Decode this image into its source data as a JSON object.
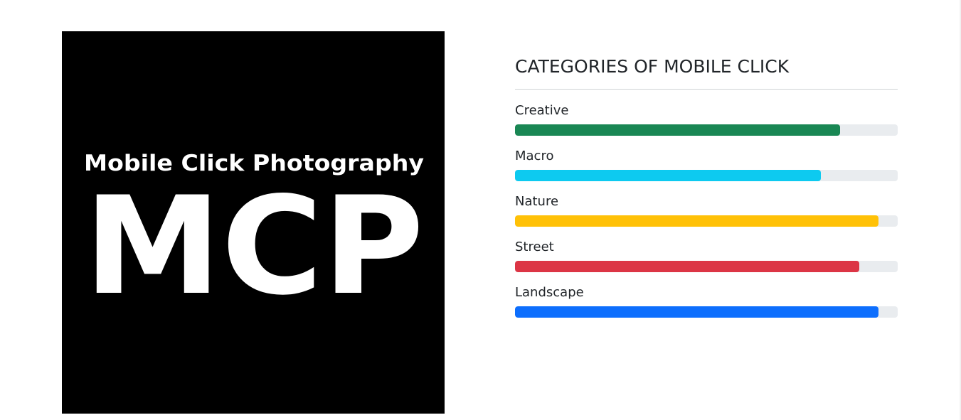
{
  "logo": {
    "line1": "Mobile Click Photography",
    "line2": "MCP",
    "background": "#000000",
    "text_color": "#ffffff"
  },
  "panel": {
    "title": "CATEGORIES OF MOBILE CLICK"
  },
  "categories": [
    {
      "label": "Creative",
      "level": 0.85,
      "color": "#198754"
    },
    {
      "label": "Macro",
      "level": 0.8,
      "color": "#0dcaf0"
    },
    {
      "label": "Nature",
      "level": 0.95,
      "color": "#ffc107"
    },
    {
      "label": "Street",
      "level": 0.9,
      "color": "#dc3545"
    },
    {
      "label": "Landscape",
      "level": 0.95,
      "color": "#0d6efd"
    }
  ]
}
